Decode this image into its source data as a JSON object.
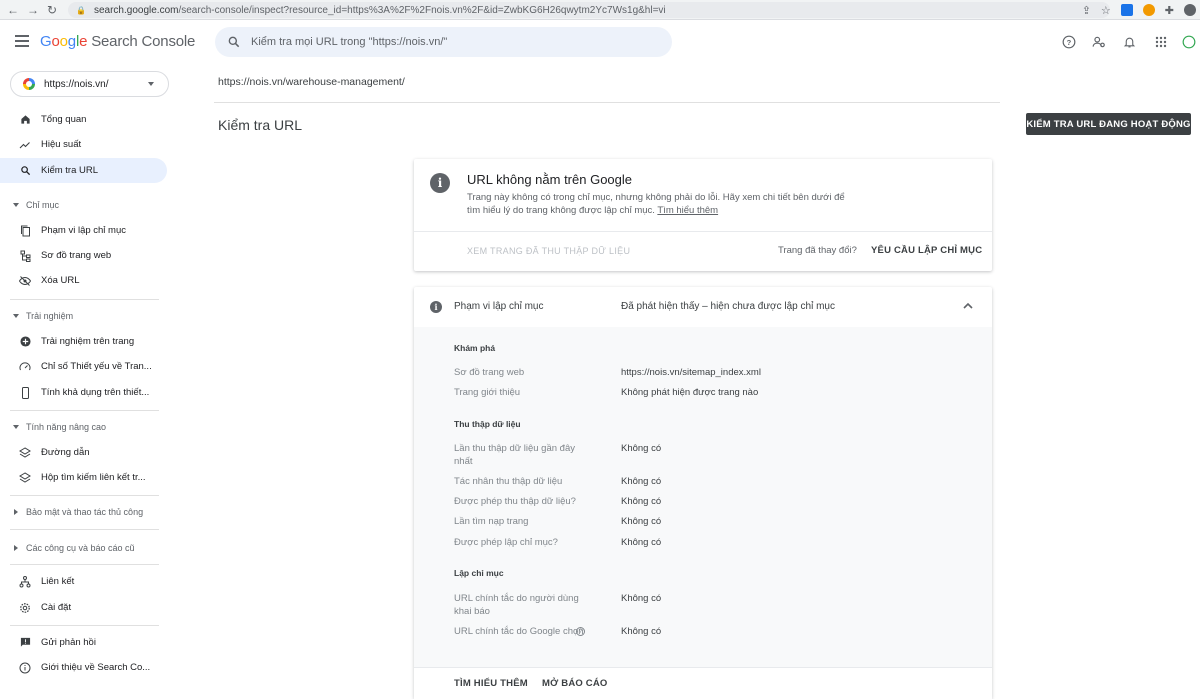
{
  "browser": {
    "url_host": "search.google.com",
    "url_path": "/search-console/inspect?resource_id=https%3A%2F%2Fnois.vn%2F&id=ZwbKG6H26qwytm2Yc7Ws1g&hl=vi"
  },
  "header": {
    "logo_google": [
      "G",
      "o",
      "o",
      "g",
      "l",
      "e"
    ],
    "logo_product": "Search Console",
    "search_placeholder": "Kiểm tra mọi URL trong \"https://nois.vn/\""
  },
  "sidebar": {
    "property": "https://nois.vn/",
    "items": {
      "overview": "Tổng quan",
      "performance": "Hiệu suất",
      "url_inspection": "Kiểm tra URL",
      "section_index": "Chỉ mục",
      "coverage": "Phạm vi lập chỉ mục",
      "sitemaps": "Sơ đồ trang web",
      "removals": "Xóa URL",
      "section_experience": "Trải nghiệm",
      "page_experience": "Trải nghiệm trên trang",
      "core_web_vitals": "Chỉ số Thiết yếu về Tran...",
      "mobile_usability": "Tính khả dụng trên thiết...",
      "section_enhancements": "Tính năng nâng cao",
      "breadcrumbs": "Đường dẫn",
      "sitelinks_searchbox": "Hộp tìm kiếm liên kết tr...",
      "section_security": "Bảo mật và thao tác thủ công",
      "section_legacy": "Các công cụ và báo cáo cũ",
      "links": "Liên kết",
      "settings": "Cài đặt",
      "feedback": "Gửi phản hồi",
      "about": "Giới thiệu về Search Co..."
    }
  },
  "main": {
    "inspected_url": "https://nois.vn/warehouse-management/",
    "page_title": "Kiểm tra URL",
    "live_test_button": "KIỂM TRA URL ĐANG HOẠT ĐỘNG",
    "status_card": {
      "title": "URL không nằm trên Google",
      "description": "Trang này không có trong chỉ mục, nhưng không phải do lỗi. Hãy xem chi tiết bên dưới để tìm hiểu lý do trang không được lập chỉ mục.",
      "learn_more_link": "Tìm hiểu thêm",
      "view_crawled": "XEM TRANG ĐÃ THU THẬP DỮ LIỆU",
      "page_changed": "Trang đã thay đổi?",
      "request_indexing": "YÊU CẦU LẬP CHỈ MỤC"
    },
    "coverage_card": {
      "label": "Phạm vi lập chỉ mục",
      "status": "Đã phát hiện thấy – hiện chưa được lập chỉ mục",
      "discovery_heading": "Khám phá",
      "sitemaps_label": "Sơ đồ trang web",
      "sitemaps_value": "https://nois.vn/sitemap_index.xml",
      "referring_label": "Trang giới thiệu",
      "referring_value": "Không phát hiện được trang nào",
      "crawl_heading": "Thu thập dữ liệu",
      "last_crawl_label": "Lần thu thập dữ liệu gần đây nhất",
      "last_crawl_value": "Không có",
      "crawler_label": "Tác nhân thu thập dữ liệu",
      "crawler_value": "Không có",
      "crawl_allowed_label": "Được phép thu thập dữ liệu?",
      "crawl_allowed_value": "Không có",
      "page_fetch_label": "Lần tìm nạp trang",
      "page_fetch_value": "Không có",
      "index_allowed_label": "Được phép lập chỉ mục?",
      "index_allowed_value": "Không có",
      "indexing_heading": "Lập chỉ mục",
      "user_canonical_label": "URL chính tắc do người dùng khai báo",
      "user_canonical_value": "Không có",
      "google_canonical_label": "URL chính tắc do Google chọn",
      "google_canonical_value": "Không có",
      "learn_more": "TÌM HIỂU THÊM",
      "open_report": "MỞ BÁO CÁO"
    }
  }
}
